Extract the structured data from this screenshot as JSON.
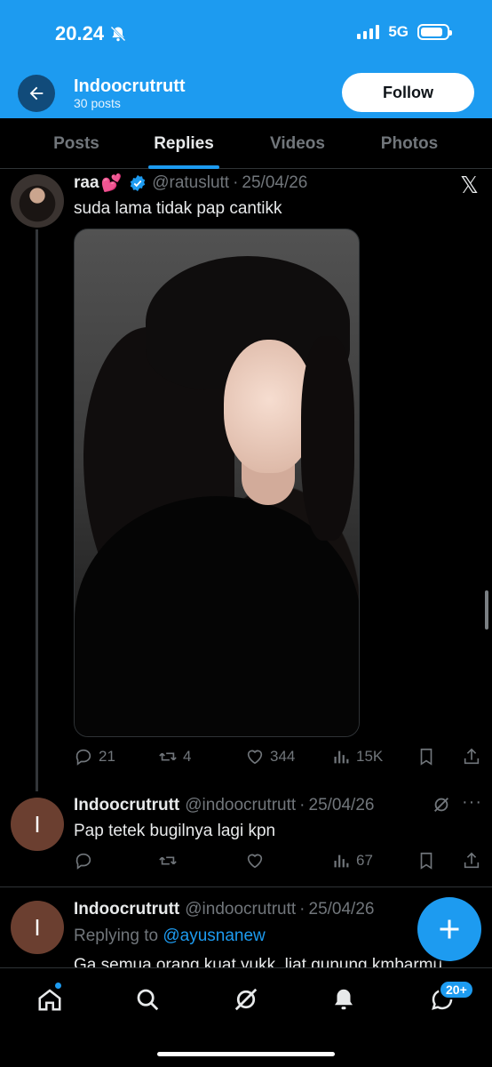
{
  "status_bar": {
    "time": "20.24",
    "network": "5G",
    "battery_pct": 85
  },
  "header": {
    "title": "Indoocrutrutt",
    "subtitle": "30 posts",
    "follow_label": "Follow"
  },
  "tabs": [
    {
      "label": "Posts",
      "active": false
    },
    {
      "label": "Replies",
      "active": true
    },
    {
      "label": "Videos",
      "active": false
    },
    {
      "label": "Photos",
      "active": false
    }
  ],
  "posts": [
    {
      "name": "raa",
      "emoji": "💕",
      "handle": "@ratuslutt",
      "date": "25/04/26",
      "text": "suda lama tidak pap cantikk",
      "replies": "21",
      "reposts": "4",
      "likes": "344",
      "views": "15K"
    },
    {
      "name": "Indoocrutrutt",
      "avatar_letter": "I",
      "handle": "@indoocrutrutt",
      "date": "25/04/26",
      "text": "Pap tetek bugilnya lagi kpn",
      "views": "67"
    },
    {
      "name": "Indoocrutrutt",
      "avatar_letter": "I",
      "handle": "@indoocrutrutt",
      "date": "25/04/26",
      "replying_prefix": "Replying to",
      "replying_to": "@ayusnanew",
      "text": "Ga semua orang kuat yukk, liat gunung kmbarmu"
    }
  ],
  "bottom_nav": {
    "messages_badge": "20+"
  },
  "colors": {
    "accent": "#1d9bf0",
    "background": "#000000",
    "muted": "#71767b"
  }
}
